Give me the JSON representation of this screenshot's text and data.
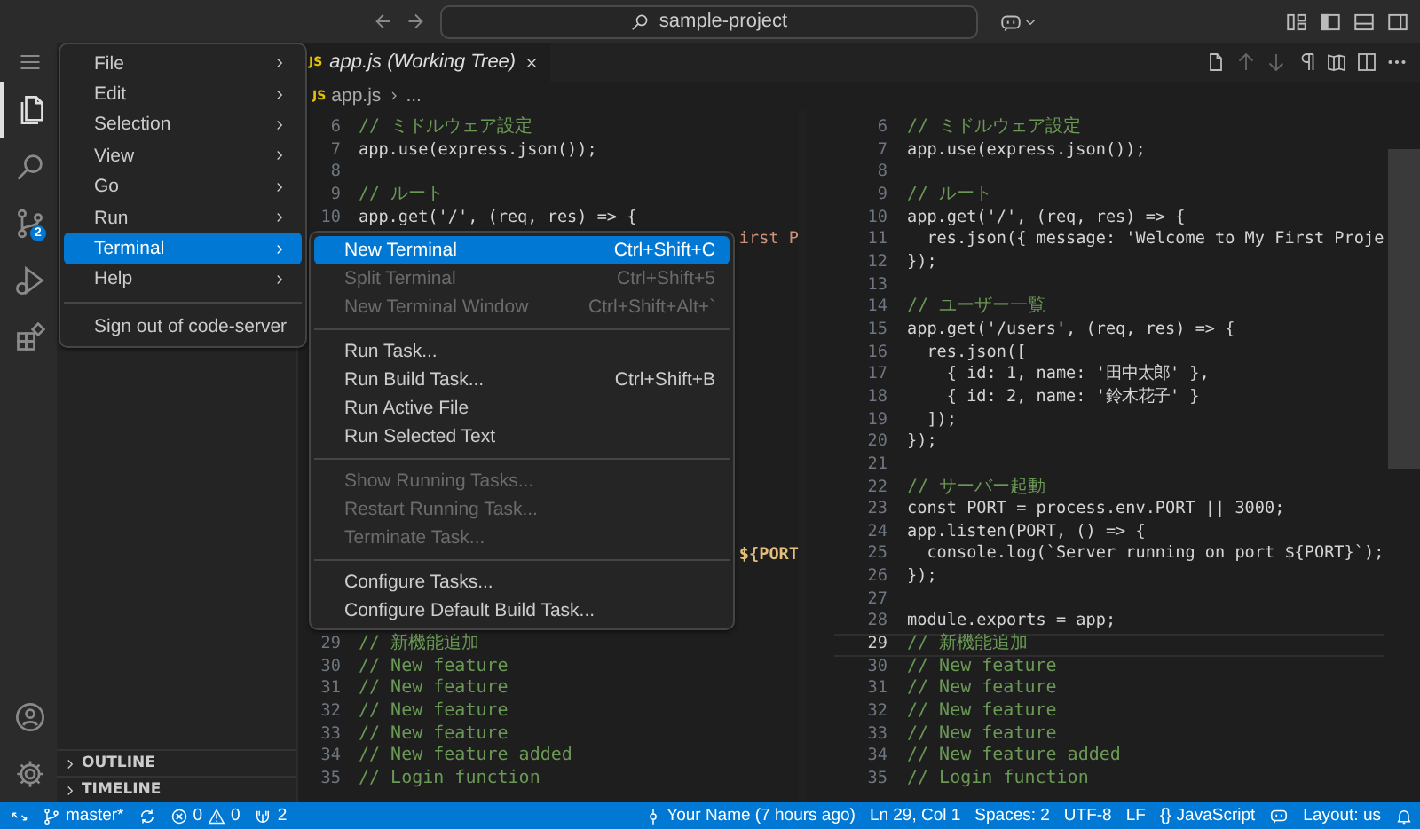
{
  "title_bar": {
    "search": "sample-project"
  },
  "activity_bar": {
    "items": [
      {
        "kind": "files",
        "selected": true
      },
      {
        "kind": "search",
        "selected": false
      },
      {
        "kind": "source-control",
        "selected": false,
        "badge": "2"
      },
      {
        "kind": "run",
        "selected": false
      },
      {
        "kind": "extensions",
        "selected": false
      }
    ]
  },
  "menu": {
    "items": [
      {
        "kind": "item",
        "label": "File",
        "submenu": true,
        "selected": false
      },
      {
        "kind": "item",
        "label": "Edit",
        "submenu": true,
        "selected": false
      },
      {
        "kind": "item",
        "label": "Selection",
        "submenu": true,
        "selected": false
      },
      {
        "kind": "item",
        "label": "View",
        "submenu": true,
        "selected": false
      },
      {
        "kind": "item",
        "label": "Go",
        "submenu": true,
        "selected": false
      },
      {
        "kind": "item",
        "label": "Run",
        "submenu": true,
        "selected": false
      },
      {
        "kind": "item",
        "label": "Terminal",
        "submenu": true,
        "selected": true
      },
      {
        "kind": "item",
        "label": "Help",
        "submenu": true,
        "selected": false
      },
      {
        "kind": "separator"
      },
      {
        "kind": "item",
        "label": "Sign out of code-server",
        "submenu": false,
        "selected": false
      }
    ]
  },
  "submenu": {
    "items": [
      {
        "kind": "item",
        "label": "New Terminal",
        "shortcut": "Ctrl+Shift+C",
        "selected": true,
        "disabled": false
      },
      {
        "kind": "item",
        "label": "Split Terminal",
        "shortcut": "Ctrl+Shift+5",
        "selected": false,
        "disabled": true
      },
      {
        "kind": "item",
        "label": "New Terminal Window",
        "shortcut": "Ctrl+Shift+Alt+`",
        "selected": false,
        "disabled": true
      },
      {
        "kind": "separator"
      },
      {
        "kind": "item",
        "label": "Run Task...",
        "selected": false,
        "disabled": false
      },
      {
        "kind": "item",
        "label": "Run Build Task...",
        "shortcut": "Ctrl+Shift+B",
        "selected": false,
        "disabled": false
      },
      {
        "kind": "item",
        "label": "Run Active File",
        "selected": false,
        "disabled": false
      },
      {
        "kind": "item",
        "label": "Run Selected Text",
        "selected": false,
        "disabled": false
      },
      {
        "kind": "separator"
      },
      {
        "kind": "item",
        "label": "Show Running Tasks...",
        "selected": false,
        "disabled": true
      },
      {
        "kind": "item",
        "label": "Restart Running Task...",
        "selected": false,
        "disabled": true
      },
      {
        "kind": "item",
        "label": "Terminate Task...",
        "selected": false,
        "disabled": true
      },
      {
        "kind": "separator"
      },
      {
        "kind": "item",
        "label": "Configure Tasks...",
        "selected": false,
        "disabled": false
      },
      {
        "kind": "item",
        "label": "Configure Default Build Task...",
        "selected": false,
        "disabled": false
      }
    ]
  },
  "sidebar": {
    "sections": [
      {
        "title": "OUTLINE",
        "expanded": false
      },
      {
        "title": "TIMELINE",
        "expanded": false
      }
    ]
  },
  "editor": {
    "tab": {
      "file_icon": "JS",
      "label": "app.js (Working Tree)"
    },
    "breadcrumb": {
      "file_icon": "JS",
      "items": [
        "app.js",
        "..."
      ]
    },
    "left_pane": {
      "lines_top": [
        {
          "number": "6",
          "text": "// ミドルウェア設定",
          "kind": "comment"
        },
        {
          "number": "7",
          "text": "app.use(express.json());",
          "kind": "code"
        },
        {
          "number": "8"
        },
        {
          "number": "9",
          "text": "// ルート",
          "kind": "comment"
        },
        {
          "number": "10",
          "text": "app.get('/', (req, res) => {",
          "kind": "code"
        }
      ],
      "line_11_fragment": {
        "text": "irst P",
        "kind": "string"
      },
      "line_25_fragment": {
        "text": "${PORT",
        "kind": "template"
      },
      "lines_bottom": [
        {
          "number": "29",
          "text": "// 新機能追加",
          "kind": "comment"
        },
        {
          "number": "30",
          "text": "// New feature",
          "kind": "comment"
        },
        {
          "number": "31",
          "text": "// New feature",
          "kind": "comment"
        },
        {
          "number": "32",
          "text": "// New feature",
          "kind": "comment"
        },
        {
          "number": "33",
          "text": "// New feature",
          "kind": "comment"
        },
        {
          "number": "34",
          "text": "// New feature added",
          "kind": "comment"
        },
        {
          "number": "35",
          "text": "// Login function",
          "kind": "comment"
        }
      ]
    },
    "right_pane": {
      "lines": [
        {
          "number": "6",
          "text": "// ミドルウェア設定",
          "kind": "comment",
          "current": false
        },
        {
          "number": "7",
          "text": "app.use(express.json());",
          "kind": "code",
          "current": false
        },
        {
          "number": "8",
          "current": false
        },
        {
          "number": "9",
          "text": "// ルート",
          "kind": "comment",
          "current": false
        },
        {
          "number": "10",
          "text": "app.get('/', (req, res) => {",
          "kind": "code",
          "current": false
        },
        {
          "number": "11",
          "text": "  res.json({ message: 'Welcome to My First Proje",
          "kind": "code",
          "current": false
        },
        {
          "number": "12",
          "text": "});",
          "kind": "code",
          "current": false
        },
        {
          "number": "13",
          "current": false
        },
        {
          "number": "14",
          "text": "// ユーザー一覧",
          "kind": "comment",
          "current": false
        },
        {
          "number": "15",
          "text": "app.get('/users', (req, res) => {",
          "kind": "code",
          "current": false
        },
        {
          "number": "16",
          "text": "  res.json([",
          "kind": "code",
          "current": false
        },
        {
          "number": "17",
          "text": "    { id: 1, name: '田中太郎' },",
          "kind": "code",
          "current": false
        },
        {
          "number": "18",
          "text": "    { id: 2, name: '鈴木花子' }",
          "kind": "code",
          "current": false
        },
        {
          "number": "19",
          "text": "  ]);",
          "kind": "code",
          "current": false
        },
        {
          "number": "20",
          "text": "});",
          "kind": "code",
          "current": false
        },
        {
          "number": "21",
          "current": false
        },
        {
          "number": "22",
          "text": "// サーバー起動",
          "kind": "comment",
          "current": false
        },
        {
          "number": "23",
          "text": "const PORT = process.env.PORT || 3000;",
          "kind": "code",
          "current": false
        },
        {
          "number": "24",
          "text": "app.listen(PORT, () => {",
          "kind": "code",
          "current": false
        },
        {
          "number": "25",
          "text": "  console.log(`Server running on port ${PORT}`);",
          "kind": "code",
          "current": false
        },
        {
          "number": "26",
          "text": "});",
          "kind": "code",
          "current": false
        },
        {
          "number": "27",
          "current": false
        },
        {
          "number": "28",
          "text": "module.exports = app;",
          "kind": "code",
          "current": false
        },
        {
          "number": "29",
          "text": "// 新機能追加",
          "kind": "comment",
          "current": true
        },
        {
          "number": "30",
          "text": "// New feature",
          "kind": "comment",
          "current": false
        },
        {
          "number": "31",
          "text": "// New feature",
          "kind": "comment",
          "current": false
        },
        {
          "number": "32",
          "text": "// New feature",
          "kind": "comment",
          "current": false
        },
        {
          "number": "33",
          "text": "// New feature",
          "kind": "comment",
          "current": false
        },
        {
          "number": "34",
          "text": "// New feature added",
          "kind": "comment",
          "current": false
        },
        {
          "number": "35",
          "text": "// Login function",
          "kind": "comment",
          "current": false
        }
      ]
    }
  },
  "status_bar": {
    "branch": "master*",
    "errors": "0",
    "warnings": "0",
    "ports": "2",
    "blame": "Your Name (7 hours ago)",
    "position": "Ln 29, Col 1",
    "indent": "Spaces: 2",
    "encoding": "UTF-8",
    "eol": "LF",
    "language_icon": "{}",
    "language": "JavaScript",
    "layout": "Layout: us"
  }
}
